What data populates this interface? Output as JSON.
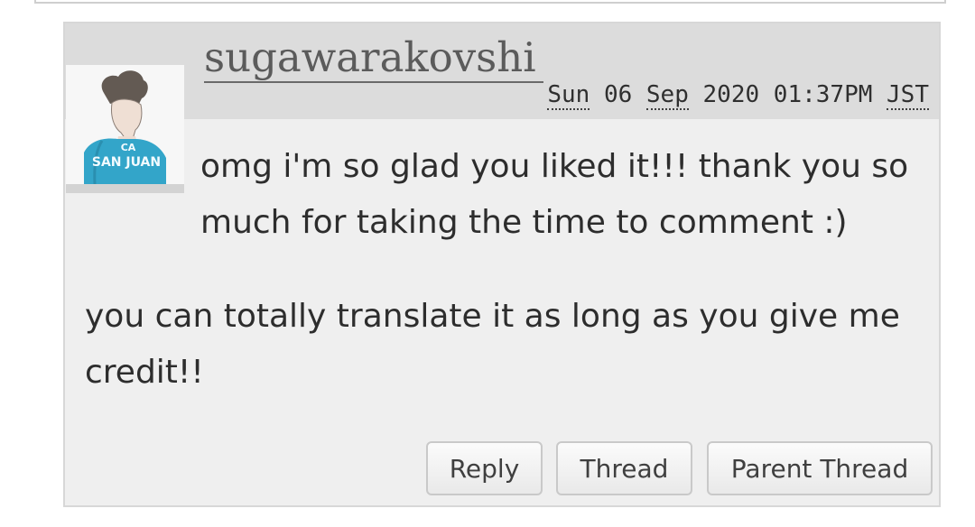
{
  "comment": {
    "username": "sugawarakovshi",
    "date": {
      "day_abbr": "Sun",
      "day": "06",
      "month_abbr": "Sep",
      "year_time": "2020 01:37PM",
      "timezone": "JST"
    },
    "message": [
      "omg i'm so glad you liked it!!! thank you so much for taking the time to comment :)",
      "you can totally translate it as long as you give me credit!!"
    ],
    "avatar": {
      "icon": "user-avatar-icon",
      "jersey_text_top": "CA",
      "jersey_text": "SAN JUAN",
      "jersey_color": "#33a5c9"
    },
    "actions": {
      "reply": "Reply",
      "thread": "Thread",
      "parent_thread": "Parent Thread"
    }
  },
  "colors": {
    "header_bg": "#dcdcdc",
    "body_bg": "#efefef",
    "username_color": "#5b5b5b"
  }
}
